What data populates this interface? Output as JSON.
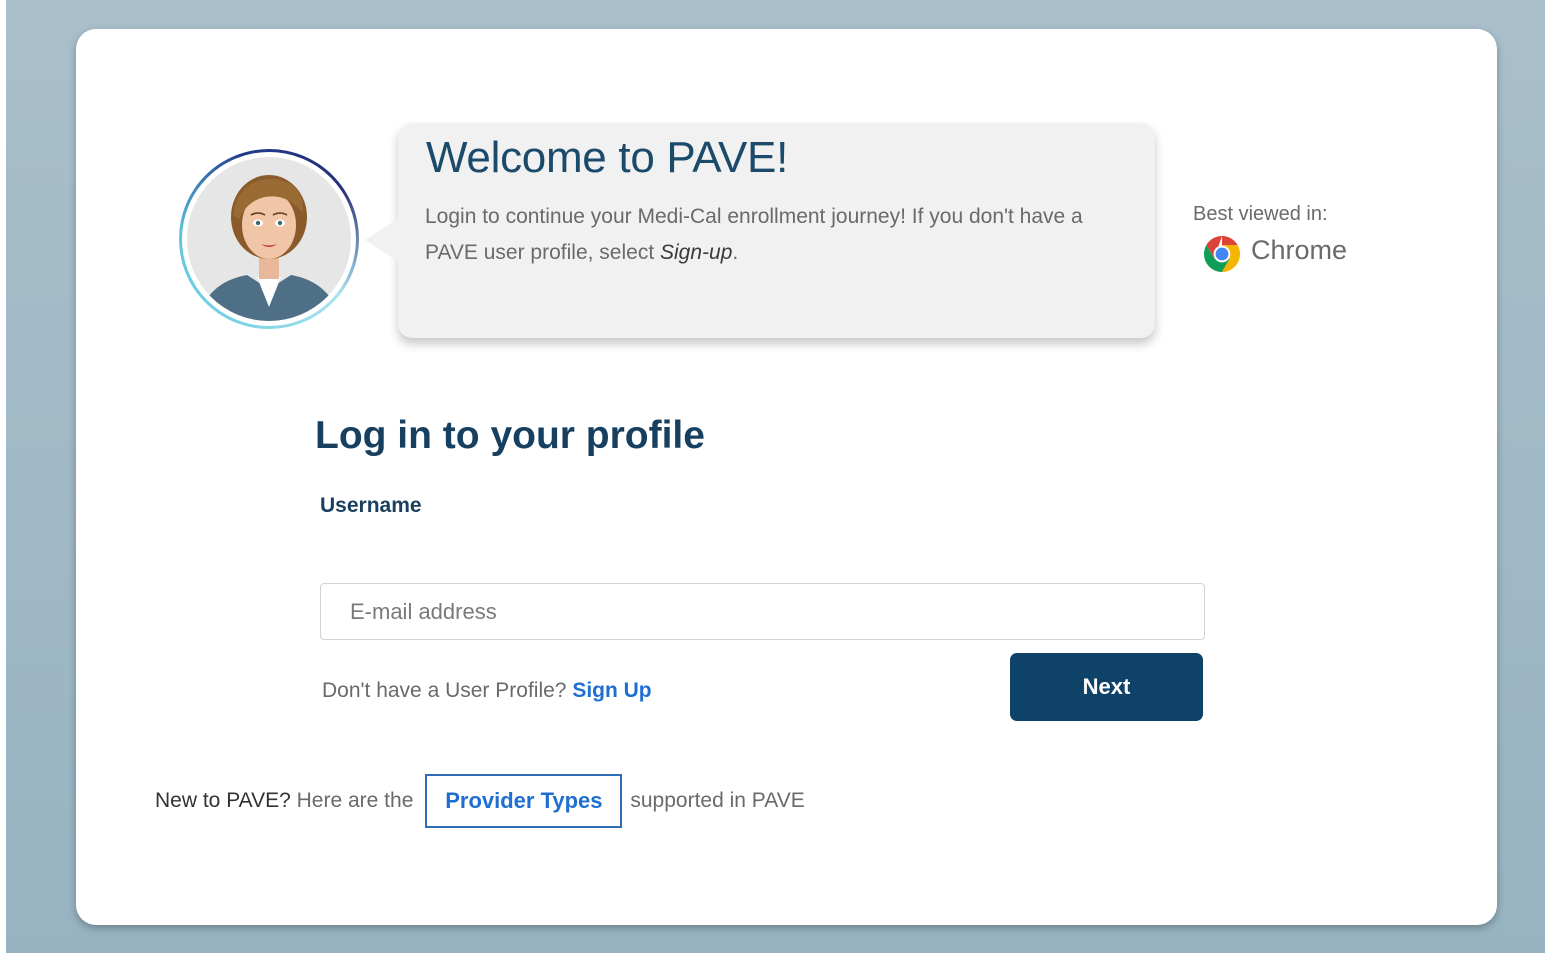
{
  "welcome": {
    "title": "Welcome to PAVE!",
    "text_before": "Login to continue your Medi-Cal enrollment journey! If you don't have a PAVE user profile, select ",
    "text_link": "Sign-up",
    "text_after": "."
  },
  "browser_hint": {
    "label": "Best viewed in:",
    "browser": "Chrome",
    "icon": "chrome-icon"
  },
  "avatar": {
    "icon": "avatar-woman-icon"
  },
  "login": {
    "title": "Log in to your profile",
    "username_label": "Username",
    "email_placeholder": "E-mail address",
    "email_value": "",
    "no_profile_text": "Don't have a User Profile?",
    "signup_label": "Sign Up",
    "next_label": "Next"
  },
  "provider": {
    "prefix_bold": "New to PAVE?",
    "prefix_rest": "Here are the",
    "button_label": "Provider Types",
    "suffix": "supported in PAVE"
  },
  "colors": {
    "background": "#a3bcc9",
    "title_blue": "#1b4a6b",
    "button_navy": "#0f4269",
    "link_blue": "#1f6fd1"
  }
}
